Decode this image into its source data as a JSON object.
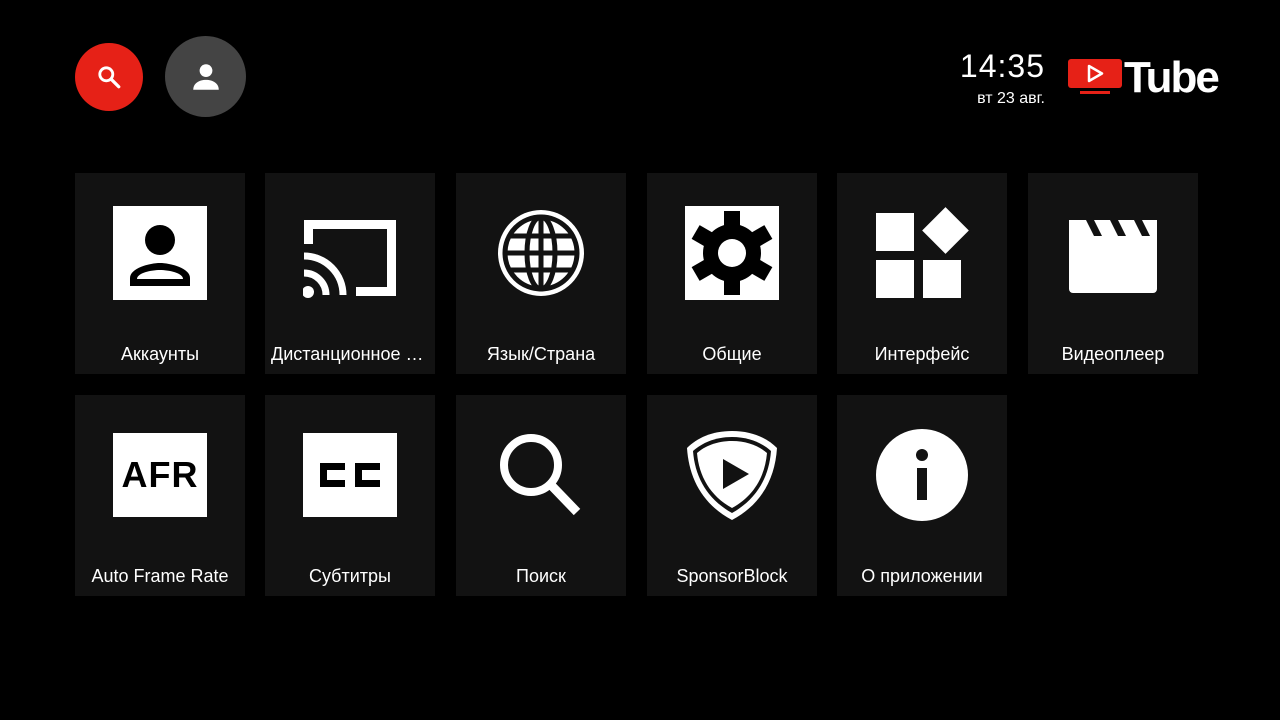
{
  "header": {
    "search_icon": "search-icon",
    "account_icon": "person-icon",
    "time": "14:35",
    "date": "вт 23 авг.",
    "logo_text": "Tube",
    "accent_color": "#e62117"
  },
  "tiles": [
    {
      "label": "Аккаунты",
      "icon": "account-icon"
    },
    {
      "label": "Дистанционное управление",
      "icon": "cast-icon"
    },
    {
      "label": "Язык/Страна",
      "icon": "globe-icon"
    },
    {
      "label": "Общие",
      "icon": "gear-icon"
    },
    {
      "label": "Интерфейс",
      "icon": "widgets-icon"
    },
    {
      "label": "Видеоплеер",
      "icon": "clapperboard-icon"
    },
    {
      "label": "Auto Frame Rate",
      "icon": "afr-icon",
      "icon_text": "AFR"
    },
    {
      "label": "Субтитры",
      "icon": "closed-captions-icon"
    },
    {
      "label": "Поиск",
      "icon": "search-icon"
    },
    {
      "label": "SponsorBlock",
      "icon": "shield-play-icon"
    },
    {
      "label": "О приложении",
      "icon": "info-icon"
    }
  ]
}
